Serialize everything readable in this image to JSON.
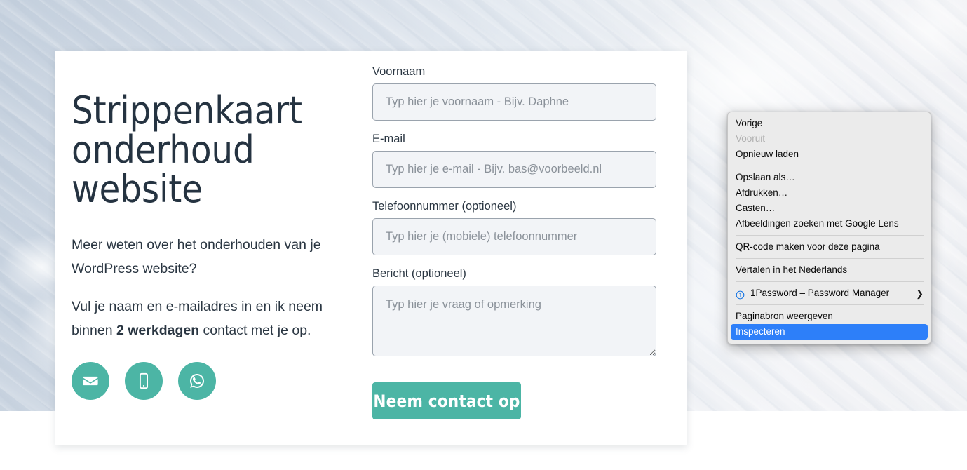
{
  "page": {
    "headline": "Strippenkaart\nonderhoud website",
    "paragraph1_text": "Meer weten over het onderhouden van je WordPress website?",
    "paragraph2_prefix": "Vul je naam en e-mailadres in en ik neem binnen ",
    "paragraph2_bold": "2 werkdagen",
    "paragraph2_suffix": " contact met je op."
  },
  "social": {
    "items": [
      {
        "name": "email-icon",
        "title": "E-mail"
      },
      {
        "name": "mobile-phone-icon",
        "title": "Telefoon"
      },
      {
        "name": "whatsapp-icon",
        "title": "WhatsApp"
      }
    ],
    "accent_color": "#4cb5a5"
  },
  "form": {
    "fields": [
      {
        "label": "Voornaam",
        "placeholder": "Typ hier je voornaam - Bijv. Daphne",
        "value": ""
      },
      {
        "label": "E-mail",
        "placeholder": "Typ hier je e-mail - Bijv. bas@voorbeeld.nl",
        "value": ""
      },
      {
        "label": "Telefoonnummer (optioneel)",
        "placeholder": "Typ hier je (mobiele) telefoonnummer",
        "value": ""
      },
      {
        "label": "Bericht (optioneel)",
        "placeholder": "Typ hier je vraag of opmerking",
        "value": ""
      }
    ],
    "submit_label": "Neem contact op",
    "submit_color": "#4cb5a5"
  },
  "context_menu": {
    "highlight_color": "#2d7ff9",
    "items": [
      {
        "label": "Vorige",
        "type": "item",
        "disabled": false
      },
      {
        "label": "Vooruit",
        "type": "item",
        "disabled": true
      },
      {
        "label": "Opnieuw laden",
        "type": "item",
        "disabled": false
      },
      {
        "type": "separator"
      },
      {
        "label": "Opslaan als…",
        "type": "item",
        "disabled": false
      },
      {
        "label": "Afdrukken…",
        "type": "item",
        "disabled": false
      },
      {
        "label": "Casten…",
        "type": "item",
        "disabled": false
      },
      {
        "label": "Afbeeldingen zoeken met Google Lens",
        "type": "item",
        "disabled": false
      },
      {
        "type": "separator"
      },
      {
        "label": "QR-code maken voor deze pagina",
        "type": "item",
        "disabled": false
      },
      {
        "type": "separator"
      },
      {
        "label": "Vertalen in het Nederlands",
        "type": "item",
        "disabled": false
      },
      {
        "type": "separator"
      },
      {
        "label": "1Password – Password Manager",
        "type": "item",
        "disabled": false,
        "icon": "onepassword-icon",
        "submenu": true
      },
      {
        "type": "separator"
      },
      {
        "label": "Paginabron weergeven",
        "type": "item",
        "disabled": false
      },
      {
        "label": "Inspecteren",
        "type": "item",
        "disabled": false,
        "selected": true
      }
    ]
  }
}
